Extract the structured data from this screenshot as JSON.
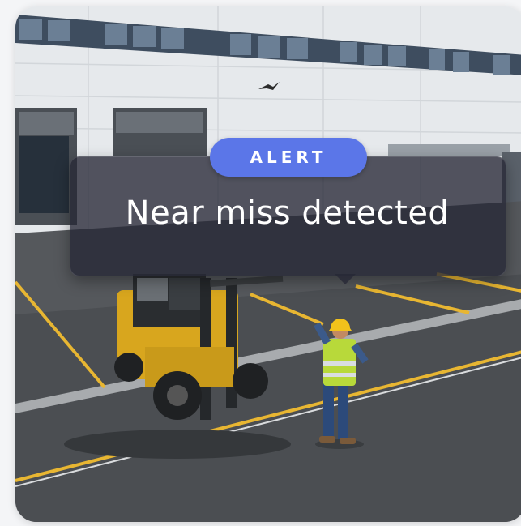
{
  "alert": {
    "badge_label": "ALERT",
    "message": "Near miss detected",
    "badge_color": "#5b76e8",
    "panel_color": "#262836"
  },
  "scene": {
    "subject": "forklift-and-worker"
  }
}
